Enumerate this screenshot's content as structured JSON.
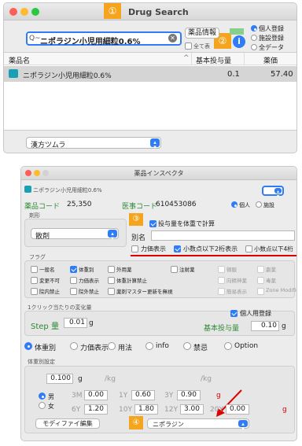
{
  "drug_search": {
    "title": "Drug Search",
    "marker1": "①",
    "marker2": "②",
    "search_value": "ニポラジン小児用細粒0.6%",
    "search_prefix": "Q~",
    "drug_info_button": "薬品情報",
    "show_all_label": "全て表",
    "radio_options": [
      "個人登録",
      "施設登録",
      "全データ"
    ],
    "columns": [
      "薬品名",
      "基本投与量",
      "薬価"
    ],
    "rows": [
      {
        "name": "ニポラジン小児用細粒0.6%",
        "dose": "0.1",
        "price": "57.40"
      }
    ],
    "footer_select": "漢方ツムラ"
  },
  "inspector": {
    "title": "薬品インスペクタ",
    "drug_label_small": "ニポラジン小児用細粒0.6%",
    "drug_code_label": "薬品コード",
    "drug_code_value": "25,350",
    "med_code_label": "医事コード",
    "med_code_value": "610453086",
    "personal_label": "個人",
    "facility_label": "施設",
    "dosage_form_label": "剤形",
    "dosage_form_value": "散剤",
    "marker3": "③",
    "weight_calc_label": "投与量を体重で計算",
    "alias_label": "別名",
    "potency_label": "力価表示",
    "two_decimal_label": "小数点以下2桁表示",
    "four_decimal_label": "小数点以下4桁",
    "flags_label": "フラグ",
    "flags": [
      [
        "一般名",
        "体重別",
        "外用薬",
        "注射薬",
        "頓服",
        "劇薬"
      ],
      [
        "変更不可",
        "力価表示",
        "体重計算禁止",
        "",
        "向精神薬",
        "毒薬"
      ],
      [
        "院内禁止",
        "院外禁止",
        "薬剤マスター更新を無視",
        "",
        "簡易表示",
        "Zone Modifier"
      ]
    ],
    "per_click_label": "1クリック当たりの変化量",
    "step_label": "Step 量",
    "step_value": "0.01",
    "step_unit": "g",
    "personal_register_label": "個人用登録",
    "base_dose_label": "基本投与量",
    "base_dose_value": "0.10",
    "base_dose_unit": "g",
    "tabs": [
      "体重別",
      "力価表示",
      "用法",
      "info",
      "禁忌",
      "Option"
    ],
    "weight_setting_label": "体重別設定",
    "weight_dose_value": "0.100",
    "weight_unit_g": "g",
    "per_kg1": "/kg",
    "per_kg2": "/kg",
    "male_label": "男",
    "female_label": "女",
    "ages": [
      {
        "label": "3M",
        "value": "0.00"
      },
      {
        "label": "1Y",
        "value": "0.60"
      },
      {
        "label": "3Y",
        "value": "0.90"
      },
      {
        "label": "6Y",
        "value": "1.20"
      },
      {
        "label": "10Y",
        "value": "1.80"
      },
      {
        "label": "12Y",
        "value": "3.00"
      },
      {
        "label": "20Y",
        "value": "0.00"
      }
    ],
    "age_unit_g": "g",
    "modify_button": "モディファイ編集",
    "marker4": "④",
    "modifier_select": "ニポラジン"
  },
  "colors": {
    "accent": "#2f7cf6",
    "marker": "#f4a51d",
    "green": "#2d8a34",
    "red": "#d00000"
  }
}
